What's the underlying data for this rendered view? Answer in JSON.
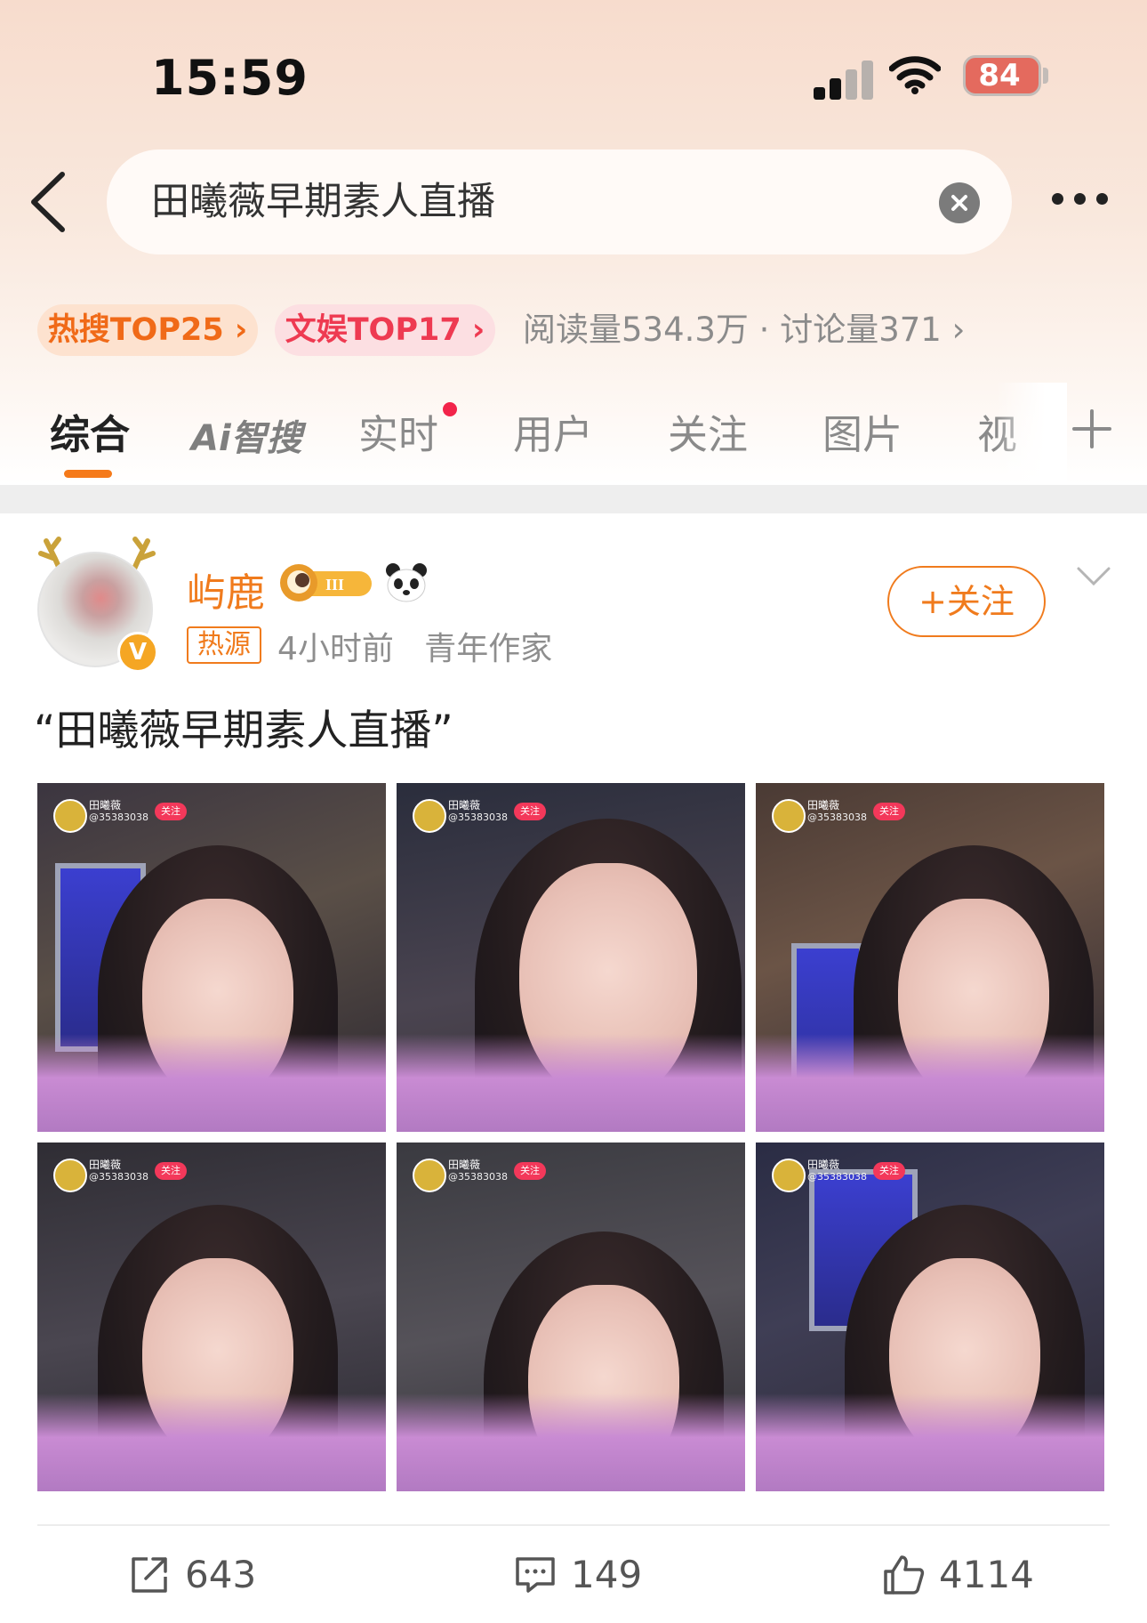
{
  "status_bar": {
    "time": "15:59",
    "battery": "84"
  },
  "search": {
    "query": "田曦薇早期素人直播"
  },
  "hot_chips": [
    {
      "label": "热搜TOP25 ›",
      "color": "#f06a18"
    },
    {
      "label": "文娱TOP17 ›",
      "color": "#ee3a51"
    }
  ],
  "read_stats": "阅读量534.3万 · 讨论量371 ›",
  "tabs": [
    {
      "label": "综合",
      "active": true
    },
    {
      "label": "Ai智搜"
    },
    {
      "label": "实时",
      "has_dot": true
    },
    {
      "label": "用户"
    },
    {
      "label": "关注"
    },
    {
      "label": "图片"
    },
    {
      "label": "视"
    }
  ],
  "post": {
    "author": "屿鹿",
    "hot_tag": "热源",
    "meta": "4小时前   青年作家",
    "follow_label": "+关注",
    "text": "“田曦薇早期素人直播”",
    "photos": [
      {
        "name": "田曦薇",
        "id": "@35383038",
        "follow": "关注"
      },
      {
        "name": "田曦薇",
        "id": "@35383038",
        "follow": "关注"
      },
      {
        "name": "田曦薇",
        "id": "@35383038",
        "follow": "关注"
      },
      {
        "name": "田曦薇",
        "id": "@35383038",
        "follow": "关注"
      },
      {
        "name": "田曦薇",
        "id": "@35383038",
        "follow": "关注"
      },
      {
        "name": "田曦薇",
        "id": "@35383038",
        "follow": "关注"
      }
    ],
    "actions": {
      "repost": "643",
      "comment": "149",
      "like": "4114"
    }
  },
  "colors": {
    "accent": "#f07b1d",
    "hot_orange": "#f06a18",
    "hot_red": "#ee3a51"
  },
  "icons": [
    "back-arrow-icon",
    "clear-icon",
    "more-icon",
    "signal-icon",
    "wifi-icon",
    "battery-icon",
    "plus-icon",
    "chevron-down-icon",
    "repost-icon",
    "comment-icon",
    "like-icon",
    "panda-icon",
    "level-badge-icon",
    "vip-badge-icon"
  ]
}
